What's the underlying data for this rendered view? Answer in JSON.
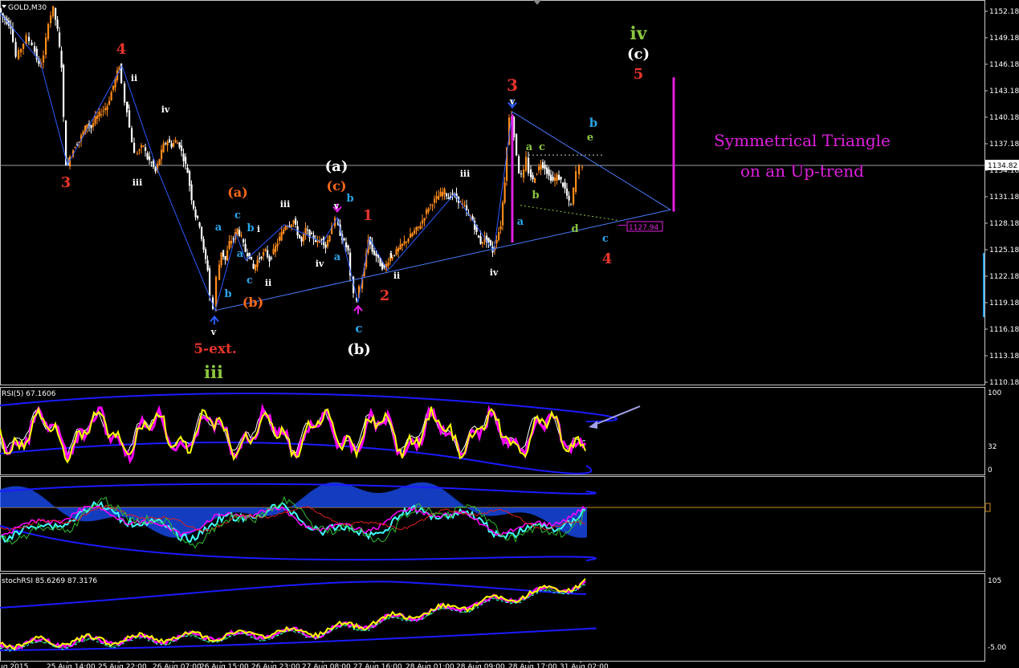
{
  "chart_data": [
    {
      "type": "candlestick",
      "panel": "main",
      "symbol_label": "GOLD,M30",
      "y_ticks": [
        "1152.18",
        "1149.18",
        "1146.18",
        "1143.18",
        "1140.18",
        "1137.18",
        "1134.18",
        "1131.18",
        "1128.18",
        "1125.18",
        "1122.18",
        "1119.18",
        "1116.18",
        "1113.18",
        "1110.18"
      ],
      "y_range": [
        1109.5,
        1153.5
      ],
      "current_price": "1134.82",
      "triangle_low_label": "1127.94",
      "x_ticks": [
        "Aug 2015",
        "25 Aug 14:00",
        "25 Aug 22:00",
        "26 Aug 07:00",
        "26 Aug 15:00",
        "26 Aug 23:00",
        "27 Aug 08:00",
        "27 Aug 16:00",
        "28 Aug 01:00",
        "28 Aug 09:00",
        "28 Aug 17:00",
        "31 Aug 02:00"
      ],
      "price_path": [
        [
          0,
          1152.5
        ],
        [
          5,
          1151.5
        ],
        [
          10,
          1151
        ],
        [
          15,
          1150.5
        ],
        [
          22,
          1147
        ],
        [
          28,
          1148
        ],
        [
          35,
          1149.2
        ],
        [
          42,
          1148.5
        ],
        [
          50,
          1146
        ],
        [
          56,
          1147
        ],
        [
          62,
          1151
        ],
        [
          68,
          1152.5
        ],
        [
          73,
          1150
        ],
        [
          78,
          1146
        ],
        [
          81,
          1140
        ],
        [
          84,
          1135
        ],
        [
          86,
          1134.6
        ],
        [
          90,
          1136
        ],
        [
          95,
          1137
        ],
        [
          100,
          1137.5
        ],
        [
          105,
          1138.5
        ],
        [
          110,
          1139.5
        ],
        [
          115,
          1139
        ],
        [
          120,
          1140
        ],
        [
          125,
          1140.5
        ],
        [
          130,
          1141
        ],
        [
          135,
          1141.5
        ],
        [
          140,
          1143
        ],
        [
          145,
          1144.5
        ],
        [
          150,
          1146
        ],
        [
          154,
          1144
        ],
        [
          157,
          1142
        ],
        [
          160,
          1141
        ],
        [
          163,
          1139
        ],
        [
          166,
          1137.5
        ],
        [
          170,
          1136
        ],
        [
          175,
          1136.5
        ],
        [
          180,
          1137
        ],
        [
          185,
          1135.5
        ],
        [
          190,
          1135
        ],
        [
          195,
          1134
        ],
        [
          200,
          1135.5
        ],
        [
          205,
          1137
        ],
        [
          210,
          1137.5
        ],
        [
          215,
          1137
        ],
        [
          220,
          1137.5
        ],
        [
          225,
          1137
        ],
        [
          230,
          1135.5
        ],
        [
          235,
          1134
        ],
        [
          240,
          1131
        ],
        [
          245,
          1129
        ],
        [
          250,
          1128
        ],
        [
          255,
          1125
        ],
        [
          260,
          1123
        ],
        [
          264,
          1120
        ],
        [
          268,
          1118.5
        ],
        [
          272,
          1122
        ],
        [
          277,
          1125
        ],
        [
          282,
          1124
        ],
        [
          287,
          1126
        ],
        [
          292,
          1126.5
        ],
        [
          297,
          1127.5
        ],
        [
          302,
          1126.5
        ],
        [
          307,
          1125
        ],
        [
          312,
          1124.5
        ],
        [
          317,
          1123
        ],
        [
          322,
          1124
        ],
        [
          327,
          1124.5
        ],
        [
          332,
          1125
        ],
        [
          337,
          1124
        ],
        [
          342,
          1125
        ],
        [
          347,
          1126
        ],
        [
          352,
          1127
        ],
        [
          357,
          1128
        ],
        [
          362,
          1128
        ],
        [
          367,
          1128.5
        ],
        [
          372,
          1127
        ],
        [
          377,
          1126
        ],
        [
          382,
          1127.5
        ],
        [
          387,
          1126.8
        ],
        [
          392,
          1126.5
        ],
        [
          397,
          1126
        ],
        [
          402,
          1126.5
        ],
        [
          407,
          1125.5
        ],
        [
          412,
          1127
        ],
        [
          416,
          1128
        ],
        [
          420,
          1128.5
        ],
        [
          425,
          1127
        ],
        [
          430,
          1126
        ],
        [
          435,
          1125
        ],
        [
          439,
          1122
        ],
        [
          443,
          1120
        ],
        [
          446,
          1119.5
        ],
        [
          450,
          1121
        ],
        [
          455,
          1123
        ],
        [
          460,
          1126.5
        ],
        [
          465,
          1125
        ],
        [
          470,
          1124.5
        ],
        [
          475,
          1123.5
        ],
        [
          480,
          1123
        ],
        [
          485,
          1124
        ],
        [
          490,
          1124.5
        ],
        [
          495,
          1125
        ],
        [
          500,
          1125.5
        ],
        [
          505,
          1126
        ],
        [
          510,
          1126.5
        ],
        [
          515,
          1127
        ],
        [
          520,
          1127.5
        ],
        [
          525,
          1128
        ],
        [
          530,
          1129
        ],
        [
          535,
          1130
        ],
        [
          540,
          1130.5
        ],
        [
          545,
          1131
        ],
        [
          550,
          1131.5
        ],
        [
          555,
          1131.8
        ],
        [
          560,
          1131
        ],
        [
          565,
          1131.5
        ],
        [
          570,
          1131
        ],
        [
          575,
          1130.5
        ],
        [
          580,
          1130
        ],
        [
          585,
          1129
        ],
        [
          590,
          1128.5
        ],
        [
          595,
          1127
        ],
        [
          600,
          1126
        ],
        [
          605,
          1126.5
        ],
        [
          610,
          1126
        ],
        [
          615,
          1125
        ],
        [
          620,
          1126.5
        ],
        [
          625,
          1128
        ],
        [
          630,
          1133
        ],
        [
          633,
          1137
        ],
        [
          636,
          1140
        ],
        [
          639,
          1140.5
        ],
        [
          642,
          1138
        ],
        [
          645,
          1136
        ],
        [
          648,
          1134
        ],
        [
          651,
          1133.5
        ],
        [
          654,
          1134
        ],
        [
          657,
          1135.5
        ],
        [
          660,
          1134
        ],
        [
          665,
          1133
        ],
        [
          670,
          1134
        ],
        [
          675,
          1135
        ],
        [
          680,
          1134.5
        ],
        [
          685,
          1133.5
        ],
        [
          690,
          1133
        ],
        [
          695,
          1133.5
        ],
        [
          700,
          1133
        ],
        [
          705,
          1132
        ],
        [
          710,
          1130.5
        ],
        [
          713,
          1130.2
        ],
        [
          716,
          1132
        ],
        [
          720,
          1134
        ],
        [
          724,
          1134.5
        ],
        [
          728,
          1134.8
        ]
      ],
      "annotations": [
        {
          "text": "3",
          "color": "#e8352b",
          "role": "wave-label"
        },
        {
          "text": "4",
          "color": "#e8352b",
          "role": "wave-label"
        },
        {
          "text": "ii",
          "color": "#ffffff",
          "role": "wave-label"
        },
        {
          "text": "i",
          "color": "#ffffff",
          "role": "wave-label"
        },
        {
          "text": "iv",
          "color": "#ffffff",
          "role": "wave-label"
        },
        {
          "text": "iii",
          "color": "#ffffff",
          "role": "wave-label"
        },
        {
          "text": "(a)",
          "color": "#ff6a1a",
          "role": "wave-label"
        },
        {
          "text": "a",
          "color": "#2aa6e8",
          "role": "wave-label"
        },
        {
          "text": "c",
          "color": "#2aa6e8",
          "role": "wave-label"
        },
        {
          "text": "b",
          "color": "#2aa6e8",
          "role": "wave-label"
        },
        {
          "text": "i",
          "color": "#ffffff",
          "role": "wave-label"
        },
        {
          "text": "a",
          "color": "#2aa6e8",
          "role": "wave-label"
        },
        {
          "text": "c",
          "color": "#2aa6e8",
          "role": "wave-label"
        },
        {
          "text": "ii",
          "color": "#ffffff",
          "role": "wave-label"
        },
        {
          "text": "b",
          "color": "#2aa6e8",
          "role": "wave-label"
        },
        {
          "text": "(b)",
          "color": "#ff6a1a",
          "role": "wave-label"
        },
        {
          "text": "v",
          "color": "#ffffff",
          "role": "wave-label"
        },
        {
          "text": "5-ext.",
          "color": "#e8352b",
          "role": "wave-label"
        },
        {
          "text": "iii",
          "color": "#8dc63f",
          "role": "wave-label"
        },
        {
          "text": "iii",
          "color": "#ffffff",
          "role": "wave-label"
        },
        {
          "text": "iv",
          "color": "#ffffff",
          "role": "wave-label"
        },
        {
          "text": "(a)",
          "color": "#ffffff",
          "role": "wave-label"
        },
        {
          "text": "(c)",
          "color": "#ff6a1a",
          "role": "wave-label"
        },
        {
          "text": "v",
          "color": "#ffffff",
          "role": "wave-label"
        },
        {
          "text": "b",
          "color": "#2aa6e8",
          "role": "wave-label"
        },
        {
          "text": "a",
          "color": "#2aa6e8",
          "role": "wave-label"
        },
        {
          "text": "1",
          "color": "#e8352b",
          "role": "wave-label"
        },
        {
          "text": "c",
          "color": "#2aa6e8",
          "role": "wave-label"
        },
        {
          "text": "(b)",
          "color": "#ffffff",
          "role": "wave-label"
        },
        {
          "text": "i",
          "color": "#ffffff",
          "role": "wave-label"
        },
        {
          "text": "ii",
          "color": "#ffffff",
          "role": "wave-label"
        },
        {
          "text": "2",
          "color": "#e8352b",
          "role": "wave-label"
        },
        {
          "text": "iii",
          "color": "#ffffff",
          "role": "wave-label"
        },
        {
          "text": "iv",
          "color": "#ffffff",
          "role": "wave-label"
        },
        {
          "text": "3",
          "color": "#e8352b",
          "role": "wave-label"
        },
        {
          "text": "v",
          "color": "#ffffff",
          "role": "wave-label"
        },
        {
          "text": "a",
          "color": "#2aa6e8",
          "role": "wave-label"
        },
        {
          "text": "a",
          "color": "#8dc63f",
          "role": "wave-label"
        },
        {
          "text": "c",
          "color": "#8dc63f",
          "role": "wave-label"
        },
        {
          "text": "b",
          "color": "#8dc63f",
          "role": "wave-label"
        },
        {
          "text": "d",
          "color": "#8dc63f",
          "role": "wave-label"
        },
        {
          "text": "e",
          "color": "#8dc63f",
          "role": "wave-label"
        },
        {
          "text": "b",
          "color": "#2aa6e8",
          "role": "wave-label"
        },
        {
          "text": "c",
          "color": "#2aa6e8",
          "role": "wave-label"
        },
        {
          "text": "4",
          "color": "#e8352b",
          "role": "wave-label"
        },
        {
          "text": "iv",
          "color": "#8dc63f",
          "role": "wave-label"
        },
        {
          "text": "(c)",
          "color": "#ffffff",
          "role": "wave-label"
        },
        {
          "text": "5",
          "color": "#e8352b",
          "role": "wave-label"
        }
      ],
      "pattern_title": [
        "Symmetrical Triangle",
        "on an  Up-trend"
      ],
      "title_color": "#e020e0"
    },
    {
      "type": "line",
      "panel": "rsi",
      "label": "RSI(5) 67.1606",
      "y_ticks": [
        "100",
        "32",
        "0"
      ],
      "ylim": [
        0,
        100
      ]
    },
    {
      "type": "area",
      "panel": "macd",
      "label": ""
    },
    {
      "type": "line",
      "panel": "stochrsi",
      "label": "stochRSI 85.6269 87.3176",
      "y_ticks": [
        "105",
        "-5.00"
      ]
    }
  ],
  "colors": {
    "bull": "#ff8c1a",
    "bear": "#ffffff",
    "wave_line": "#2a5cff",
    "triangle": "#4a7bff",
    "magenta": "#e020e0",
    "rsi_main": "#ffff00",
    "rsi_alt": "#ff00ff",
    "band": "#1a1aff",
    "cyan": "#40ffff"
  }
}
